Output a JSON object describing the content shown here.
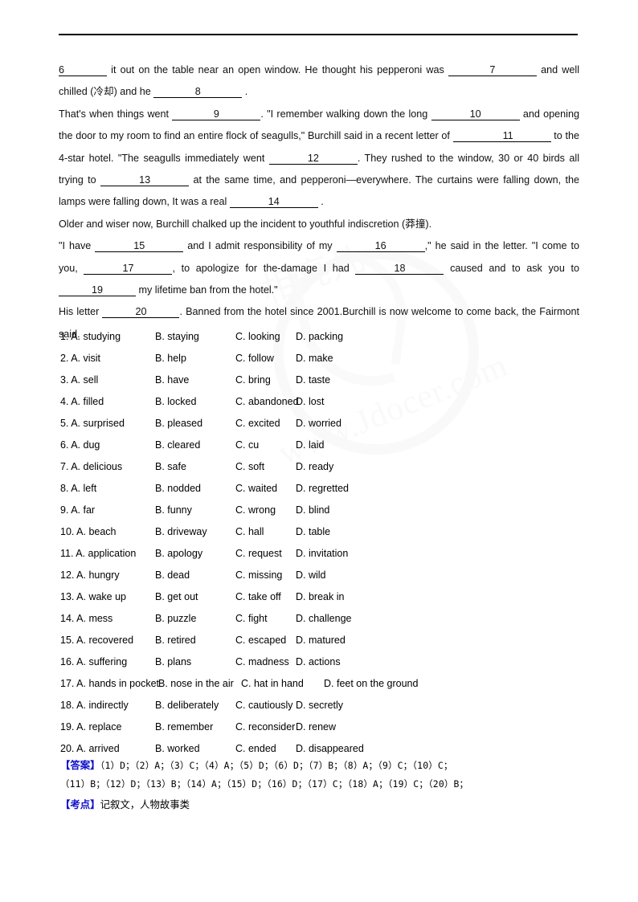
{
  "document": {
    "watermark": {
      "cn_text": "相亮儿",
      "url_text": "www.Jdocer.com"
    },
    "passage": {
      "lines": [
        {
          "segments": [
            {
              "type": "blank",
              "label": "6",
              "style": "lead"
            },
            {
              "type": "text",
              "value": " it out on the table near an open window. He thought his pepperoni was "
            },
            {
              "type": "blank",
              "label": "7",
              "style": "wide"
            },
            {
              "type": "text",
              "value": " and well chilled (冷却) and he "
            },
            {
              "type": "blank",
              "label": "8",
              "style": "wide"
            },
            {
              "type": "text",
              "value": " ."
            }
          ]
        },
        {
          "segments": [
            {
              "type": "text",
              "value": "That's when things went "
            },
            {
              "type": "blank",
              "label": "9",
              "style": "wide"
            },
            {
              "type": "text",
              "value": ". \"I remember walking down the long "
            },
            {
              "type": "blank",
              "label": "10",
              "style": "wide"
            },
            {
              "type": "text",
              "value": " and opening the door to my room to find an entire flock of seagulls,\" Burchill said in a recent letter of "
            },
            {
              "type": "blank",
              "label": "",
              "style": "empty"
            },
            {
              "type": "blank",
              "label": "11",
              "style": "lead"
            },
            {
              "type": "text",
              "value": " to the 4-star hotel. \"The seagulls immediately went "
            },
            {
              "type": "blank",
              "label": "12",
              "style": "wide"
            },
            {
              "type": "text",
              "value": ". They rushed to the window, 30 or 40 birds all trying to "
            },
            {
              "type": "blank",
              "label": "13",
              "style": "wide"
            },
            {
              "type": "text",
              "value": " at the same time, and pepperoni—everywhere. The curtains were falling down, the lamps were falling down, It was a real "
            },
            {
              "type": "blank",
              "label": "14",
              "style": "wide"
            },
            {
              "type": "text",
              "value": " ."
            }
          ]
        },
        {
          "segments": [
            {
              "type": "text",
              "value": "Older and wiser now, Burchill chalked up the incident to youthful indiscretion (莽撞)."
            }
          ]
        },
        {
          "segments": [
            {
              "type": "text",
              "value": "\"I have "
            },
            {
              "type": "blank",
              "label": "15",
              "style": "wide"
            },
            {
              "type": "text",
              "value": " and I admit responsibility of my "
            },
            {
              "type": "blank",
              "label": "16",
              "style": "wide"
            },
            {
              "type": "text",
              "value": ",\" he said in the letter. \"I come to you, "
            },
            {
              "type": "blank",
              "label": "17",
              "style": "wide"
            },
            {
              "type": "text",
              "value": ", to apologize for the-damage I had "
            },
            {
              "type": "blank",
              "label": "18",
              "style": "wide"
            },
            {
              "type": "text",
              "value": " caused and to ask you to "
            },
            {
              "type": "blank",
              "label": "19",
              "style": "mid"
            },
            {
              "type": "text",
              "value": " my lifetime ban from the hotel.\""
            }
          ]
        },
        {
          "segments": [
            {
              "type": "text",
              "value": "His letter "
            },
            {
              "type": "blank",
              "label": "20",
              "style": "mid"
            },
            {
              "type": "text",
              "value": ". Banned from the hotel since 2001.Burchill is now welcome to come back, the Fairmont said."
            }
          ]
        }
      ]
    },
    "options": [
      {
        "num": "1.",
        "a": "A. studying",
        "b": "B. staying",
        "c": "C. looking",
        "d": "D. packing",
        "wide": false
      },
      {
        "num": "2.",
        "a": "A. visit",
        "b": "B. help",
        "c": "C. follow",
        "d": "D. make",
        "wide": false
      },
      {
        "num": "3.",
        "a": "A. sell",
        "b": "B. have",
        "c": "C. bring",
        "d": "D. taste",
        "wide": false
      },
      {
        "num": "4.",
        "a": "A. filled",
        "b": "B. locked",
        "c": "C. abandoned",
        "d": "D. lost",
        "wide": false
      },
      {
        "num": "5.",
        "a": "A. surprised",
        "b": "B. pleased",
        "c": "C. excited",
        "d": "D. worried",
        "wide": false
      },
      {
        "num": "6.",
        "a": "A. dug",
        "b": "B. cleared",
        "c": "C. cu",
        "d": "D. laid",
        "wide": false
      },
      {
        "num": "7.",
        "a": "A. delicious",
        "b": "B. safe",
        "c": "C. soft",
        "d": "D. ready",
        "wide": false
      },
      {
        "num": "8.",
        "a": "A. left",
        "b": "B. nodded",
        "c": "C. waited",
        "d": "D. regretted",
        "wide": false
      },
      {
        "num": "9.",
        "a": "A. far",
        "b": "B. funny",
        "c": "C. wrong",
        "d": "D. blind",
        "wide": false
      },
      {
        "num": "10.",
        "a": "A. beach",
        "b": "B. driveway",
        "c": "C. hall",
        "d": "D. table",
        "wide": false
      },
      {
        "num": "11.",
        "a": "A. application",
        "b": "B. apology",
        "c": "C. request",
        "d": "D. invitation",
        "wide": false
      },
      {
        "num": "12.",
        "a": "A. hungry",
        "b": "B. dead",
        "c": "C. missing",
        "d": "D. wild",
        "wide": false
      },
      {
        "num": "13.",
        "a": "A. wake up",
        "b": "B. get out",
        "c": "C. take off",
        "d": "D. break in",
        "wide": false
      },
      {
        "num": "14.",
        "a": "A. mess",
        "b": "B. puzzle",
        "c": "C. fight",
        "d": "D. challenge",
        "wide": false
      },
      {
        "num": "15.",
        "a": "A. recovered",
        "b": "B. retired",
        "c": "C. escaped",
        "d": "D. matured",
        "wide": false
      },
      {
        "num": "16.",
        "a": "A. suffering",
        "b": "B. plans",
        "c": "C. madness",
        "d": "D. actions",
        "wide": false
      },
      {
        "num": "17.",
        "a": "A. hands in pocket",
        "b": "B. nose in the air",
        "c": "C. hat in hand",
        "d": "D. feet on the ground",
        "wide": true
      },
      {
        "num": "18.",
        "a": "A. indirectly",
        "b": "B. deliberately",
        "c": "C. cautiously",
        "d": "D. secretly",
        "wide": false
      },
      {
        "num": "19.",
        "a": "A. replace",
        "b": "B. remember",
        "c": "C. reconsider",
        "d": "D. renew",
        "wide": false
      },
      {
        "num": "20.",
        "a": "A. arrived",
        "b": "B. worked",
        "c": "C. ended",
        "d": "D. disappeared",
        "wide": false
      }
    ],
    "answer_key": {
      "label": "【答案】",
      "line1": "（1）D；（2）A；（3）C；（4）A；（5）D；（6）D；（7）B；（8）A；（9）C；（10）C；",
      "line2": "（11）B；（12）D；（13）B；（14）A；（15）D；（16）D；（17）C；（18）A；（19）C；（20）B；"
    },
    "exam_point": {
      "label": "【考点】",
      "value": "记叙文，人物故事类"
    },
    "colors": {
      "tag_blue": "#1111cc",
      "body_black": "#111111"
    }
  }
}
